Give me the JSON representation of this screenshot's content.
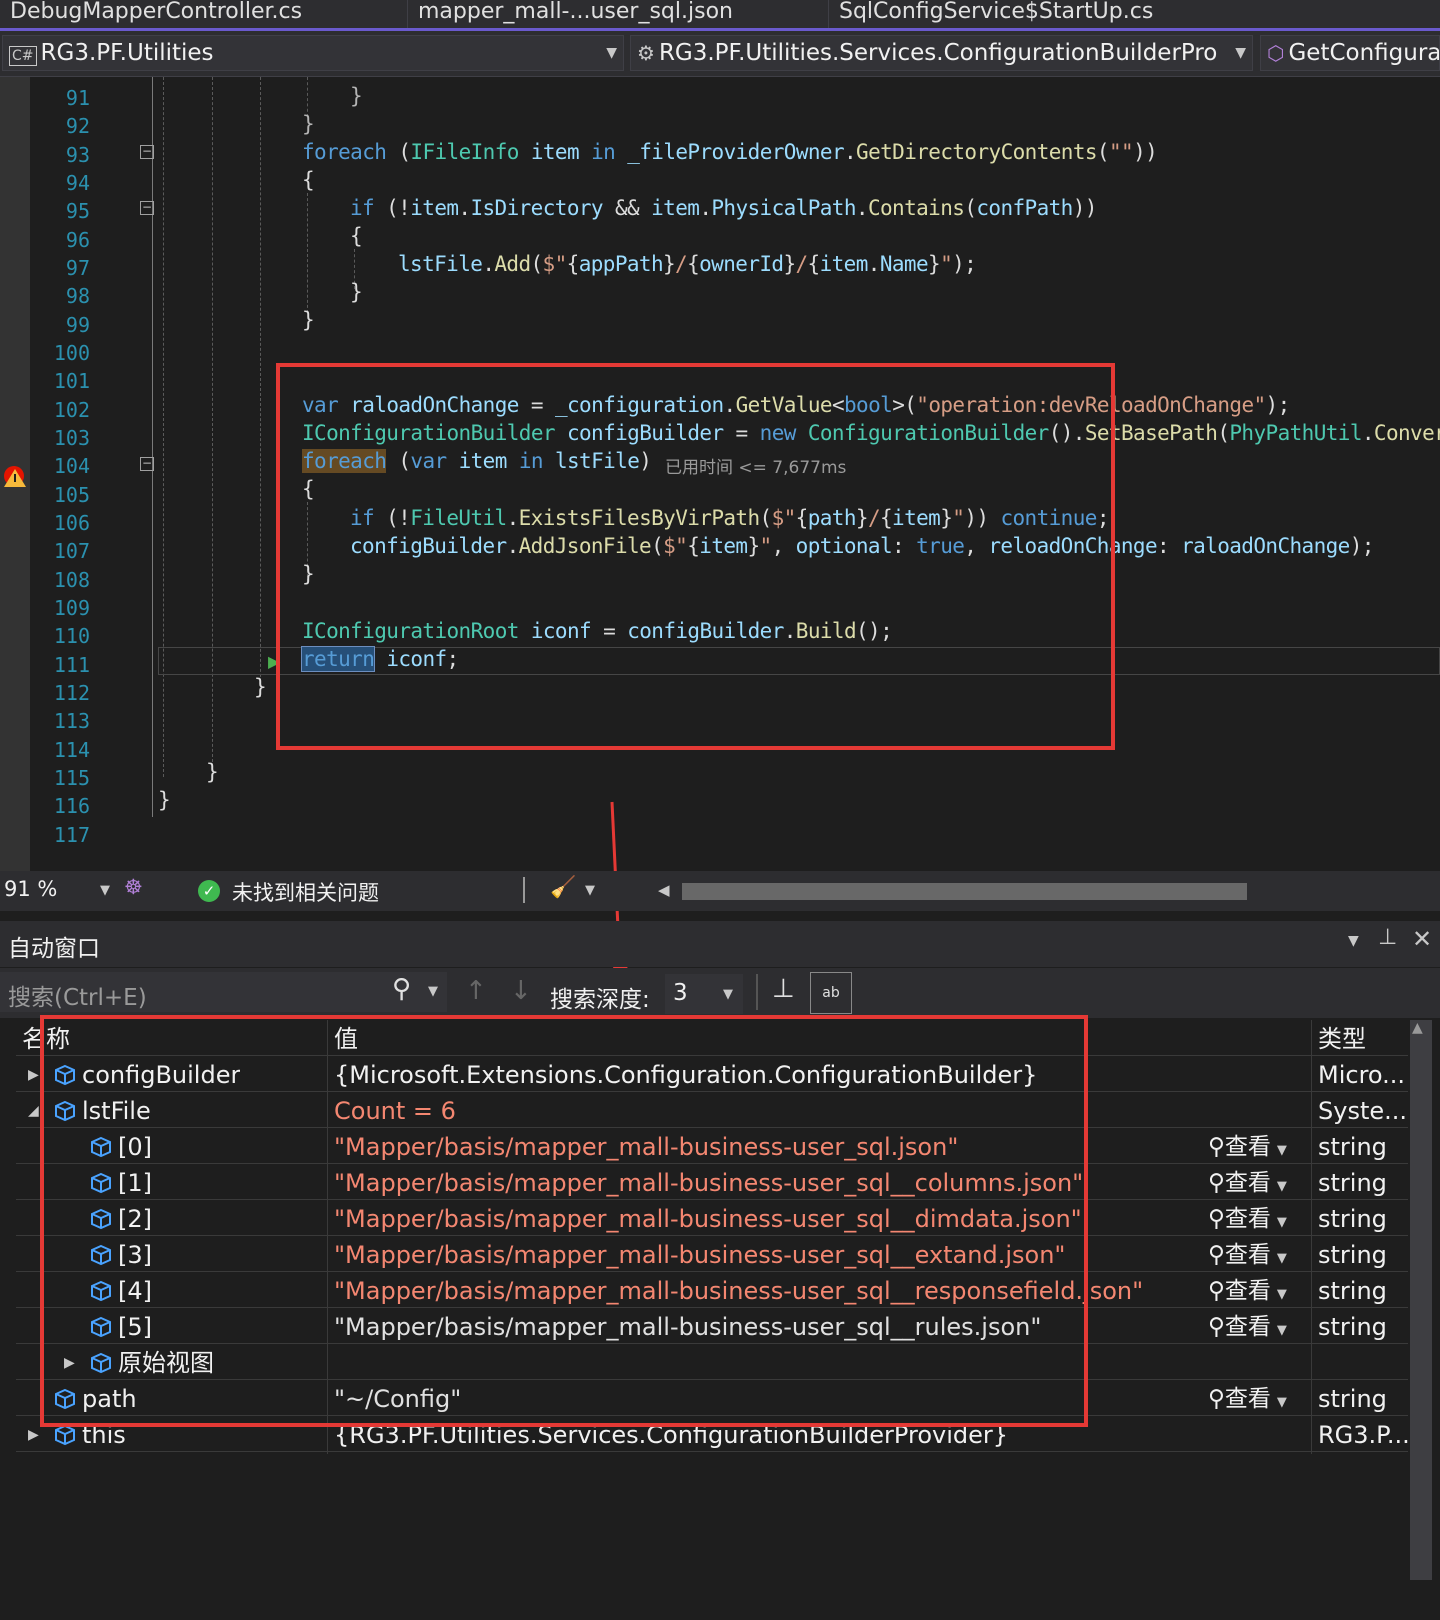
{
  "tabs": [
    {
      "label": "DebugMapperController.cs"
    },
    {
      "label": "mapper_mall-...user_sql.json"
    },
    {
      "label": "SqlConfigService$StartUp.cs"
    }
  ],
  "nav": {
    "project_badge": "C#",
    "project": "RG3.PF.Utilities",
    "class": "RG3.PF.Utilities.Services.ConfigurationBuilderPro",
    "member": "GetConfigura"
  },
  "editor": {
    "line_numbers": [
      "91",
      "92",
      "93",
      "94",
      "95",
      "96",
      "97",
      "98",
      "99",
      "100",
      "101",
      "102",
      "103",
      "104",
      "105",
      "106",
      "107",
      "108",
      "109",
      "110",
      "111",
      "112",
      "113",
      "114",
      "115",
      "116",
      "117"
    ],
    "perf_tip": "已用时间 <= 7,677ms"
  },
  "status": {
    "zoom": "91 %",
    "issues": "未找到相关问题"
  },
  "autos": {
    "title": "自动窗口",
    "search_placeholder": "搜索(Ctrl+E)",
    "depth_label": "搜索深度:",
    "depth_value": "3",
    "headers": {
      "name": "名称",
      "value": "值",
      "type": "类型"
    },
    "view_label": "查看",
    "rows": [
      {
        "name": "configBuilder",
        "value": "{Microsoft.Extensions.Configuration.ConfigurationBuilder}",
        "type": "Micro..."
      },
      {
        "name": "lstFile",
        "value": "Count = 6",
        "type": "Syste..."
      },
      {
        "name": "[0]",
        "value": "\"Mapper/basis/mapper_mall-business-user_sql.json\"",
        "type": "string"
      },
      {
        "name": "[1]",
        "value": "\"Mapper/basis/mapper_mall-business-user_sql__columns.json\"",
        "type": "string"
      },
      {
        "name": "[2]",
        "value": "\"Mapper/basis/mapper_mall-business-user_sql__dimdata.json\"",
        "type": "string"
      },
      {
        "name": "[3]",
        "value": "\"Mapper/basis/mapper_mall-business-user_sql__extand.json\"",
        "type": "string"
      },
      {
        "name": "[4]",
        "value": "\"Mapper/basis/mapper_mall-business-user_sql__responsefield.json\"",
        "type": "string"
      },
      {
        "name": "[5]",
        "value": "\"Mapper/basis/mapper_mall-business-user_sql__rules.json\"",
        "type": "string"
      },
      {
        "name": "原始视图",
        "value": "",
        "type": ""
      },
      {
        "name": "path",
        "value": "\"~/Config\"",
        "type": "string"
      },
      {
        "name": "this",
        "value": "{RG3.PF.Utilities.Services.ConfigurationBuilderProvider}",
        "type": "RG3.P..."
      }
    ]
  },
  "colors": {
    "accent": "#6a5acd",
    "annotation": "#e53935",
    "changed_value": "#f48771"
  }
}
